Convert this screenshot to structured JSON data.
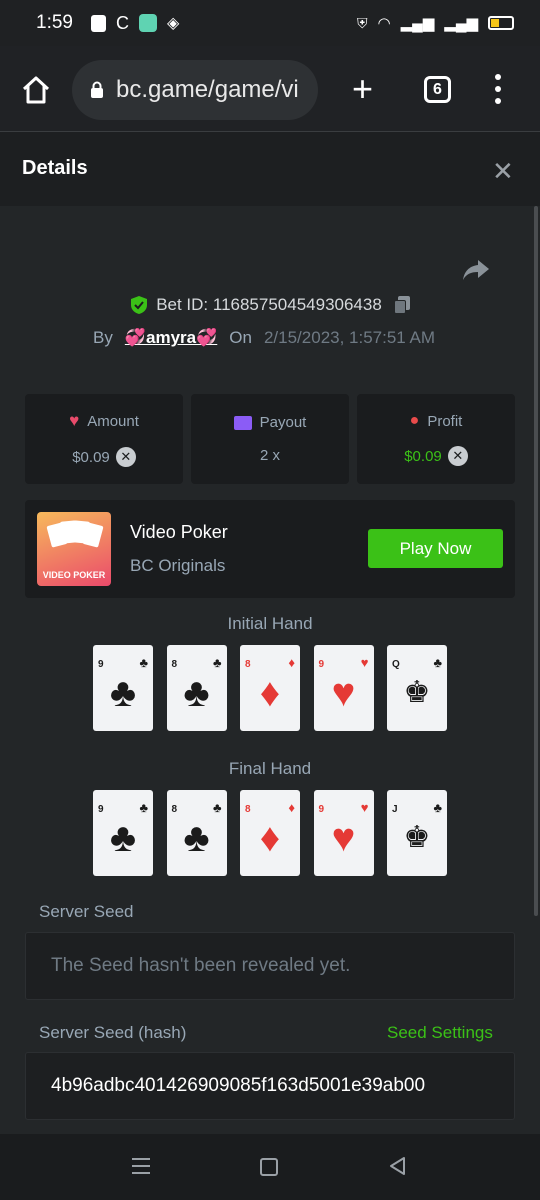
{
  "status_bar": {
    "time": "1:59"
  },
  "browser": {
    "url": "bc.game/game/vi",
    "tab_count": "6"
  },
  "header": {
    "title": "Details",
    "close": "✕"
  },
  "bet": {
    "id_text": "Bet ID: 116857504549306438",
    "by_label": "By",
    "username": "💞amyra💞",
    "on_label": "On",
    "date": "2/15/2023, 1:57:51 AM"
  },
  "stats": [
    {
      "label": "Amount",
      "value": "$0.09",
      "color": "#e94b6b"
    },
    {
      "label": "Payout",
      "value": "2 x",
      "color": "#8b5cf6"
    },
    {
      "label": "Profit",
      "value": "$0.09",
      "color": "#e94b4b"
    }
  ],
  "game": {
    "thumb_label": "VIDEO POKER",
    "name": "Video Poker",
    "provider": "BC Originals",
    "play_label": "Play Now",
    "accent": "#3bc117"
  },
  "initial_hand": {
    "label": "Initial Hand",
    "cards": [
      {
        "rank": "9",
        "suit": "♣",
        "color": "black"
      },
      {
        "rank": "8",
        "suit": "♣",
        "color": "black"
      },
      {
        "rank": "8",
        "suit": "♦",
        "color": "red"
      },
      {
        "rank": "9",
        "suit": "♥",
        "color": "red"
      },
      {
        "rank": "Q",
        "suit": "♣",
        "color": "black"
      }
    ]
  },
  "final_hand": {
    "label": "Final Hand",
    "cards": [
      {
        "rank": "9",
        "suit": "♣",
        "color": "black"
      },
      {
        "rank": "8",
        "suit": "♣",
        "color": "black"
      },
      {
        "rank": "8",
        "suit": "♦",
        "color": "red"
      },
      {
        "rank": "9",
        "suit": "♥",
        "color": "red"
      },
      {
        "rank": "J",
        "suit": "♣",
        "color": "black"
      }
    ]
  },
  "server_seed": {
    "label": "Server Seed",
    "value": "The Seed hasn't been revealed yet."
  },
  "server_seed_hash": {
    "label": "Server Seed (hash)",
    "settings_label": "Seed Settings",
    "value": "4b96adbc401426909085f163d5001e39ab00"
  }
}
